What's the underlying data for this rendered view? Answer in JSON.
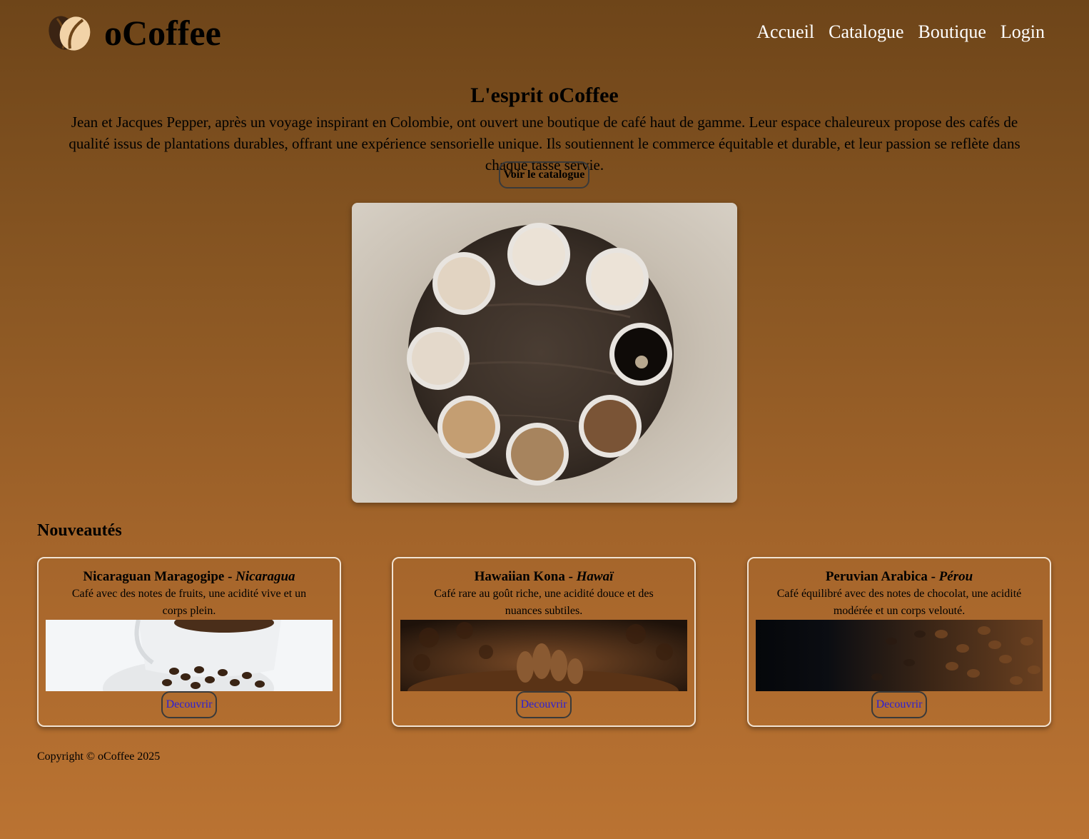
{
  "header": {
    "brand": "oCoffee",
    "logo_icon": "coffee-bean-icon",
    "nav": [
      {
        "label": "Accueil"
      },
      {
        "label": "Catalogue"
      },
      {
        "label": "Boutique"
      },
      {
        "label": "Login"
      }
    ]
  },
  "intro": {
    "title": "L'esprit oCoffee",
    "text": "Jean et Jacques Pepper, après un voyage inspirant en Colombie, ont ouvert une boutique de café haut de gamme. Leur espace chaleureux propose des cafés de qualité issus de plantations durables, offrant une expérience sensorielle unique. Ils soutiennent le commerce équitable et durable, et leur passion se reflète dans chaque tasse servie.",
    "button_label": "Voir le catalogue"
  },
  "news": {
    "title": "Nouveautés",
    "cards": [
      {
        "name": "Nicaraguan Maragogipe",
        "separator": " - ",
        "origin": "Nicaragua",
        "description": "Café avec des notes de fruits, une acidité vive et un corps plein.",
        "button_label": "Decouvrir"
      },
      {
        "name": "Hawaiian Kona",
        "separator": " - ",
        "origin": "Hawaï",
        "description": "Café rare au goût riche, une acidité douce et des nuances subtiles.",
        "button_label": "Decouvrir"
      },
      {
        "name": "Peruvian Arabica",
        "separator": " - ",
        "origin": "Pérou",
        "description": "Café équilibré avec des notes de chocolat, une acidité modérée et un corps velouté.",
        "button_label": "Decouvrir"
      }
    ]
  },
  "footer": {
    "copyright": "Copyright © oCoffee 2025"
  },
  "colors": {
    "background_top": "#6e4519",
    "background_bottom": "#ba7332",
    "link_blue": "#2a1fd6",
    "nav_text": "#ffffff"
  }
}
